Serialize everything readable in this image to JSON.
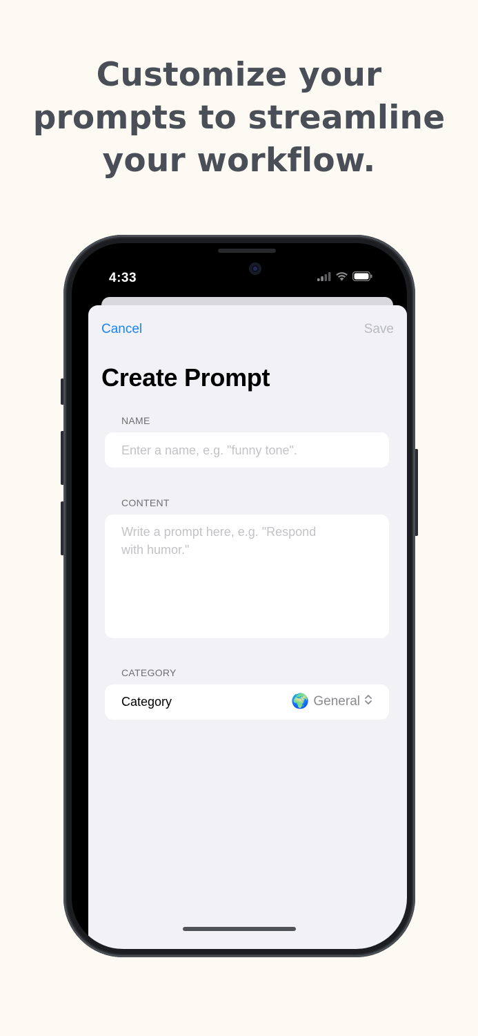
{
  "headline": {
    "line1": "Customize your",
    "line2": "prompts to streamline",
    "line3": "your workflow."
  },
  "status_bar": {
    "time": "4:33",
    "icons": [
      "cellular-signal-icon",
      "wifi-icon",
      "battery-icon"
    ]
  },
  "nav": {
    "cancel_label": "Cancel",
    "save_label": "Save"
  },
  "form": {
    "title": "Create Prompt",
    "name_section_label": "NAME",
    "name_placeholder": "Enter a name, e.g. \"funny tone\".",
    "content_section_label": "CONTENT",
    "content_placeholder_line1": "Write a prompt here, e.g. \"Respond",
    "content_placeholder_line2": "with humor.\"",
    "category_section_label": "CATEGORY",
    "category_label": "Category",
    "category_value": "General",
    "category_icon": "globe-emoji"
  },
  "colors": {
    "background": "#fdfaf3",
    "headline": "#4a4f57",
    "accent": "#1a83f5",
    "sheet": "#f1f1f6"
  }
}
